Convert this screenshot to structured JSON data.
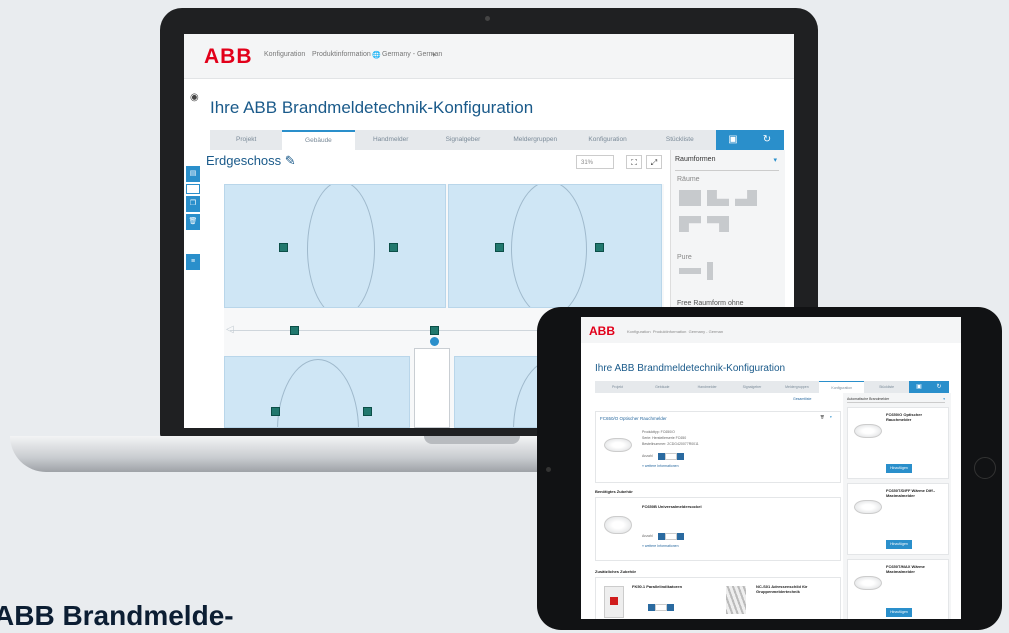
{
  "app": {
    "logo_text": "ABB",
    "nav": {
      "konfiguration": "Konfiguration",
      "produktinformation": "Produktinformation",
      "language": "Germany - German"
    },
    "title": "Ihre ABB Brandmeldetechnik-Konfiguration",
    "tabs": [
      "Projekt",
      "Gebäude",
      "Handmelder",
      "Signalgeber",
      "Meldergruppen",
      "Konfiguration",
      "Stückliste"
    ],
    "active_tab": "Gebäude",
    "floor_name": "Erdgeschoss",
    "zoom": "31%",
    "panel": {
      "dropdown": "Raumformen",
      "rooms_label": "Räume",
      "walls_label": "Pure",
      "freeform_text": "Free Raumform ohne"
    }
  },
  "tablet": {
    "title": "Ihre ABB Brandmeldetechnik-Konfiguration",
    "active_tab": "Konfiguration",
    "link": "Gesamtliste",
    "right_dropdown": "Automatische Brandmelder",
    "detector_title": "FC650/O Optischer Rauchmelder",
    "section_required": "Benötigtes Zubehör",
    "accessory_title": "FC650B Universalmeldersockel",
    "section_additional": "Zusätzliches Zubehör",
    "acc2_title": "FK50.1 Parallelindikatoren",
    "acc3_title": "NC-S01 Adressenschild für Gruppenmeldertechnik",
    "more_info": "» weitere Informationen",
    "anzahl": "Anzahl",
    "product_lines": [
      "Produkttyp: FC650/O",
      "Serie: Herstellerserie FC650",
      "Bestellnummer: 2CDG420077R0011"
    ],
    "right_items": [
      {
        "name": "FC650/O Optischer Rauchmelder",
        "button": "Hinzufügen"
      },
      {
        "name": "FC650T/DIFF Wärme Diff.-Maximalmelder",
        "button": "Hinzufügen"
      },
      {
        "name": "FC650T/MAX Wärme Maximalmelder",
        "button": "Hinzufügen"
      }
    ]
  },
  "caption": "ABB Brandmelde-"
}
